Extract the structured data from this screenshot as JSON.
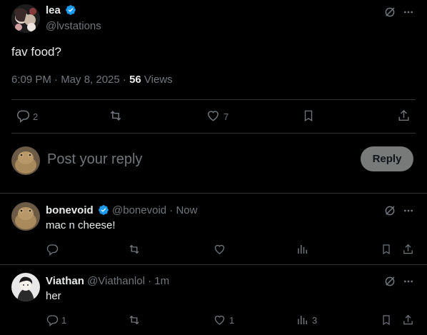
{
  "post": {
    "display_name": "lea",
    "handle": "@lvstations",
    "text": "fav food?",
    "timestamp": "6:09 PM · May 8, 2025 · ",
    "views_count": "56",
    "views_label": " Views",
    "replies": "2",
    "likes": "7"
  },
  "composer": {
    "placeholder": "Post your reply",
    "button_label": "Reply"
  },
  "replies": [
    {
      "display_name": "bonevoid",
      "handle": "@bonevoid",
      "time": " · Now",
      "text": "mac n cheese!",
      "replies": "",
      "likes": "",
      "views": ""
    },
    {
      "display_name": "Viathan",
      "handle": "@Viathanlol",
      "time": " · 1m",
      "text": "her",
      "replies": "1",
      "likes": "1",
      "views": "3"
    }
  ],
  "colors": {
    "background": "#000000",
    "text": "#e7e9ea",
    "muted": "#71767b",
    "divider": "#2f3336",
    "verified": "#1d9bf0",
    "reply_button": "#787a7a"
  }
}
